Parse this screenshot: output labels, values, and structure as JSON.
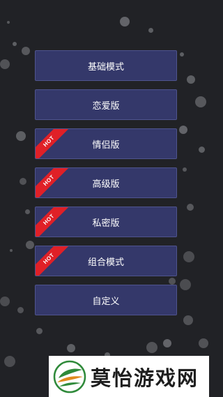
{
  "menu": {
    "items": [
      {
        "label": "基础模式",
        "hot": false
      },
      {
        "label": "恋爱版",
        "hot": false
      },
      {
        "label": "情侣版",
        "hot": true
      },
      {
        "label": "高级版",
        "hot": true
      },
      {
        "label": "私密版",
        "hot": true
      },
      {
        "label": "组合模式",
        "hot": true
      },
      {
        "label": "自定义",
        "hot": false
      }
    ],
    "hot_label": "HOT"
  },
  "watermark": {
    "text": "莫怡游戏网",
    "icon": "leaf-logo-icon"
  },
  "colors": {
    "background": "#212226",
    "button": "#34386a",
    "button_border": "#4f548e",
    "ribbon": "#e02027",
    "logo_green": "#2f8a3a",
    "logo_orange": "#e08a1e"
  }
}
